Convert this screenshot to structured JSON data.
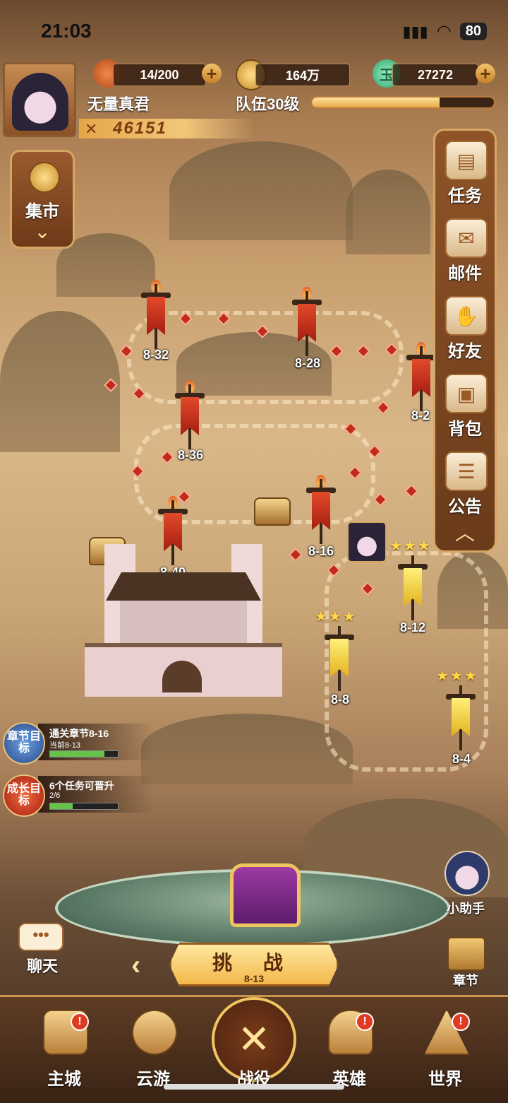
{
  "status_bar": {
    "time": "21:03",
    "battery": "80"
  },
  "player": {
    "name": "无量真君",
    "team_level_label": "队伍30级",
    "xp_progress": 0.7,
    "power": "46151"
  },
  "resources": {
    "stamina": "14/200",
    "coins": "164万",
    "jade": "27272",
    "jade_icon_char": "玉"
  },
  "left_menu": {
    "market_label": "集市"
  },
  "right_menu": {
    "items": [
      {
        "label": "任务",
        "icon": "scroll-icon"
      },
      {
        "label": "邮件",
        "icon": "mail-icon"
      },
      {
        "label": "好友",
        "icon": "handshake-icon"
      },
      {
        "label": "背包",
        "icon": "bag-icon"
      },
      {
        "label": "公告",
        "icon": "notice-icon"
      }
    ]
  },
  "stages": {
    "s8_32": "8-32",
    "s8_28": "8-28",
    "s8_24": "8-2",
    "s8_36": "8-36",
    "s8_40": "8-40",
    "s8_16": "8-16",
    "s8_12": "8-12",
    "s8_8": "8-8",
    "s8_4": "8-4",
    "s8_20_partial": "8"
  },
  "stars": "★★★",
  "goals": {
    "chapter": {
      "badge": "章节目标",
      "title": "通关章节8-16",
      "subtitle": "当前8-13",
      "progress": 0.8
    },
    "achievement": {
      "badge": "成长目标",
      "title": "6个任务可晋升",
      "subtitle": "2/6",
      "progress": 0.33
    }
  },
  "actions": {
    "challenge_label": "挑 战",
    "challenge_stage": "8-13",
    "chat_label": "聊天",
    "chat_icon_glyph": "•••",
    "helper_label": "小助手",
    "chapter_label": "章节"
  },
  "bottom_nav": {
    "main_city": "主城",
    "travel": "云游",
    "battle": "战役",
    "heroes": "英雄",
    "world": "世界",
    "badge_mark": "!"
  }
}
